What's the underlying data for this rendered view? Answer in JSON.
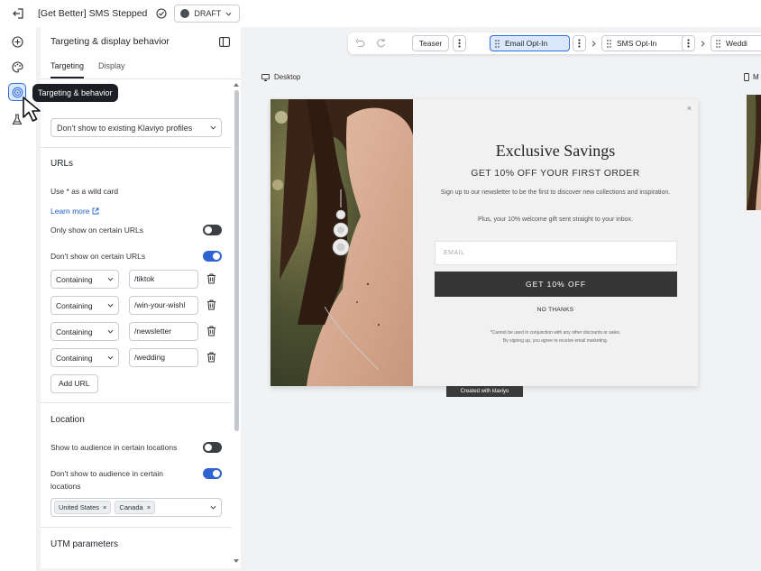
{
  "topbar": {
    "title": "[Get Better] SMS Stepped",
    "status": "DRAFT"
  },
  "tooltip": "Targeting & behavior",
  "panel": {
    "title": "Targeting & display behavior",
    "tabs": [
      "Targeting",
      "Display"
    ],
    "existing_profiles_select": "Don't show to existing Klaviyo profiles",
    "urls": {
      "title": "URLs",
      "wildcard_hint": "Use * as a wild card",
      "learn_more": "Learn more",
      "only_show_label": "Only show on certain URLs",
      "only_show_on": false,
      "dont_show_label": "Don't show on certain URLs",
      "dont_show_on": true,
      "rules": [
        {
          "match": "Containing",
          "value": "/tiktok"
        },
        {
          "match": "Containing",
          "value": "/win-your-wishl"
        },
        {
          "match": "Containing",
          "value": "/newsletter"
        },
        {
          "match": "Containing",
          "value": "/wedding"
        }
      ],
      "add_url": "Add URL"
    },
    "location": {
      "title": "Location",
      "show_label": "Show to audience in certain locations",
      "show_on": false,
      "dont_show_label_line1": "Don't show to audience in certain",
      "dont_show_label_line2": "locations",
      "dont_show_on": true,
      "chips": [
        "United States",
        "Canada"
      ]
    },
    "utm": {
      "title": "UTM parameters"
    }
  },
  "toolbar": {
    "steps": [
      "Teaser",
      "Email Opt-In",
      "SMS Opt-In",
      "Weddi"
    ],
    "active_step": "Email Opt-In"
  },
  "canvas": {
    "desktop_label": "Desktop",
    "mobile_label": "M"
  },
  "popup": {
    "heading": "Exclusive Savings",
    "subheading": "GET 10% OFF YOUR FIRST ORDER",
    "body1": "Sign up to our newsletter to be the first to discover new collections and inspiration.",
    "body2": "Plus, your 10% welcome gift sent straight to your inbox.",
    "email_placeholder": "EMAIL",
    "cta": "GET 10% OFF",
    "no_thanks": "NO THANKS",
    "fine_print_line1": "*Cannot be used in conjunction with any other discounts or sales.",
    "fine_print_line2": "By signing up, you agree to receive email marketing.",
    "close": "×",
    "badge": "Created with klaviyo"
  },
  "colors": {
    "accent": "#2f63d1",
    "active_bg": "#dbe7fb",
    "cta_bg": "#363636"
  }
}
